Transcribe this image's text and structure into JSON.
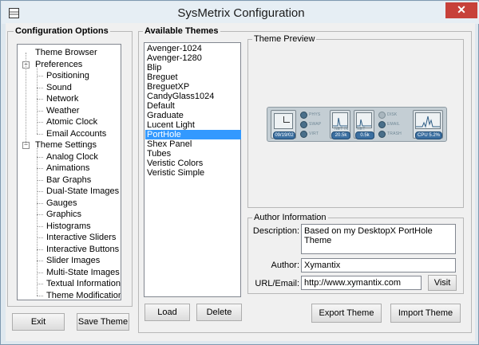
{
  "window": {
    "title": "SysMetrix Configuration",
    "close_glyph": "✕"
  },
  "config_options": {
    "label": "Configuration Options",
    "tree": [
      {
        "label": "Theme Browser",
        "level": 0
      },
      {
        "label": "Preferences",
        "level": 0,
        "expander": "−"
      },
      {
        "label": "Positioning",
        "level": 1
      },
      {
        "label": "Sound",
        "level": 1
      },
      {
        "label": "Network",
        "level": 1
      },
      {
        "label": "Weather",
        "level": 1
      },
      {
        "label": "Atomic Clock",
        "level": 1
      },
      {
        "label": "Email Accounts",
        "level": 1
      },
      {
        "label": "Theme Settings",
        "level": 0,
        "expander": "−"
      },
      {
        "label": "Analog Clock",
        "level": 1
      },
      {
        "label": "Animations",
        "level": 1
      },
      {
        "label": "Bar Graphs",
        "level": 1
      },
      {
        "label": "Dual-State Images",
        "level": 1
      },
      {
        "label": "Gauges",
        "level": 1
      },
      {
        "label": "Graphics",
        "level": 1
      },
      {
        "label": "Histograms",
        "level": 1
      },
      {
        "label": "Interactive Sliders",
        "level": 1
      },
      {
        "label": "Interactive Buttons",
        "level": 1
      },
      {
        "label": "Slider Images",
        "level": 1
      },
      {
        "label": "Multi-State Images",
        "level": 1
      },
      {
        "label": "Textual Information",
        "level": 1
      },
      {
        "label": "Theme Modification",
        "level": 1
      }
    ],
    "exit_label": "Exit",
    "save_label": "Save Theme"
  },
  "themes": {
    "label": "Available Themes",
    "items": [
      "Avenger-1024",
      "Avenger-1280",
      "Blip",
      "Breguet",
      "BreguetXP",
      "CandyGlass1024",
      "Default",
      "Graduate",
      "Lucent Light",
      "PortHole",
      "Shex Panel",
      "Tubes",
      "Veristic Colors",
      "Veristic Simple"
    ],
    "selected": "PortHole",
    "load_label": "Load",
    "delete_label": "Delete"
  },
  "preview": {
    "label": "Theme Preview",
    "widget": {
      "clock_time": "09/19/02",
      "mem_labels": [
        "PHYS",
        "SWAP",
        "VIRT"
      ],
      "graph1_caption": "NET IN",
      "graph1_value": "20.5k",
      "graph2_caption": "NET OUT",
      "graph2_value": "0.5k",
      "drive_labels": [
        "DISK",
        "EMAIL",
        "TRASH"
      ],
      "cpu_value": "CPU 5.2%"
    }
  },
  "author_info": {
    "label": "Author Information",
    "description_label": "Description:",
    "description_value": "Based on my DesktopX PortHole Theme",
    "author_label": "Author:",
    "author_value": "Xymantix",
    "url_label": "URL/Email:",
    "url_value": "http://www.xymantix.com",
    "visit_label": "Visit"
  },
  "export_label": "Export Theme",
  "import_label": "Import Theme",
  "colors": {
    "selection": "#3399ff",
    "close_button": "#c7413a",
    "widget_accent": "#3b6fa0"
  }
}
